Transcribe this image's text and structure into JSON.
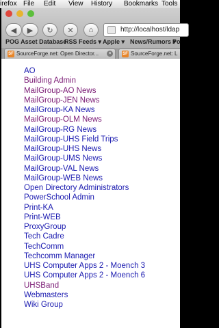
{
  "menubar": {
    "items": [
      "irefox",
      "File",
      "Edit",
      "View",
      "History",
      "Bookmarks",
      "Tools"
    ]
  },
  "toolbar": {
    "back_label": "◀",
    "forward_label": "▶",
    "reload_label": "↻",
    "stop_label": "✕",
    "home_label": "⌂",
    "url_value": "http://localhost/ldap"
  },
  "bookmarks": {
    "items": [
      "POG Asset Database",
      "RSS Feeds ▾",
      "Apple ▾",
      "News/Rumors ▾",
      "Po"
    ]
  },
  "tabs": [
    {
      "icon": "SF",
      "label": "SourceForge.net: Open Director..."
    },
    {
      "icon": "SF",
      "label": "SourceForge.net: L"
    }
  ],
  "colors": {
    "link_unvisited": "#1b1bb0",
    "link_visited": "#7a1a74"
  },
  "groups": [
    {
      "label": "AO",
      "visited": false
    },
    {
      "label": "Building Admin",
      "visited": true
    },
    {
      "label": "MailGroup-AO News",
      "visited": true
    },
    {
      "label": "MailGroup-JEN News",
      "visited": true
    },
    {
      "label": "MailGroup-KA News",
      "visited": false
    },
    {
      "label": "MailGroup-OLM News",
      "visited": true
    },
    {
      "label": "MailGroup-RG News",
      "visited": false
    },
    {
      "label": "MailGroup-UHS Field Trips",
      "visited": false
    },
    {
      "label": "MailGroup-UHS News",
      "visited": false
    },
    {
      "label": "MailGroup-UMS News",
      "visited": false
    },
    {
      "label": "MailGroup-VAL News",
      "visited": false
    },
    {
      "label": "MailGroup-WEB News",
      "visited": false
    },
    {
      "label": "Open Directory Administrators",
      "visited": false
    },
    {
      "label": "PowerSchool Admin",
      "visited": false
    },
    {
      "label": "Print-KA",
      "visited": false
    },
    {
      "label": "Print-WEB",
      "visited": false
    },
    {
      "label": "ProxyGroup",
      "visited": false
    },
    {
      "label": "Tech Cadre",
      "visited": false
    },
    {
      "label": "TechComm",
      "visited": false
    },
    {
      "label": "Techcomm Manager",
      "visited": false
    },
    {
      "label": "UHS Computer Apps 2 - Moench 3",
      "visited": false
    },
    {
      "label": "UHS Computer Apps 2 - Moench 6",
      "visited": false
    },
    {
      "label": "UHSBand",
      "visited": true
    },
    {
      "label": "Webmasters",
      "visited": false
    },
    {
      "label": "Wiki Group",
      "visited": false
    }
  ]
}
